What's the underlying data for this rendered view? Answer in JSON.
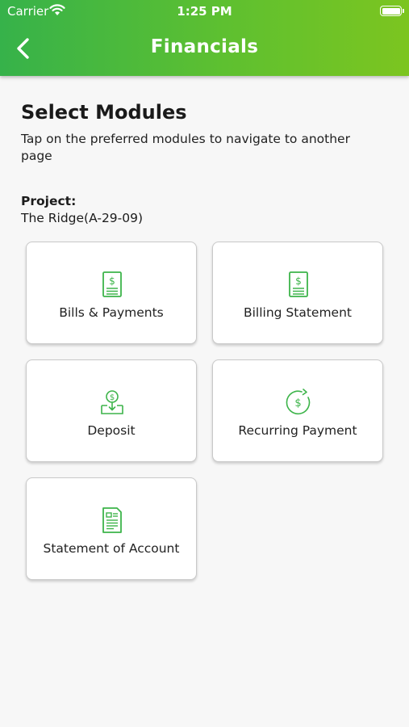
{
  "status_bar": {
    "carrier": "Carrier",
    "time": "1:25 PM"
  },
  "header": {
    "title": "Financials"
  },
  "content": {
    "heading": "Select Modules",
    "subtitle": "Tap on the preferred modules to navigate to another page",
    "project_label": "Project:",
    "project_value": "The Ridge(A-29-09)"
  },
  "modules": [
    {
      "label": "Bills & Payments",
      "icon": "bill-document-icon"
    },
    {
      "label": "Billing Statement",
      "icon": "billing-statement-icon"
    },
    {
      "label": "Deposit",
      "icon": "deposit-box-icon"
    },
    {
      "label": "Recurring Payment",
      "icon": "recurring-payment-icon"
    },
    {
      "label": "Statement of Account",
      "icon": "statement-document-icon"
    }
  ],
  "colors": {
    "accent": "#3db44a",
    "header_gradient_start": "#36b24a",
    "header_gradient_end": "#7cc520"
  }
}
